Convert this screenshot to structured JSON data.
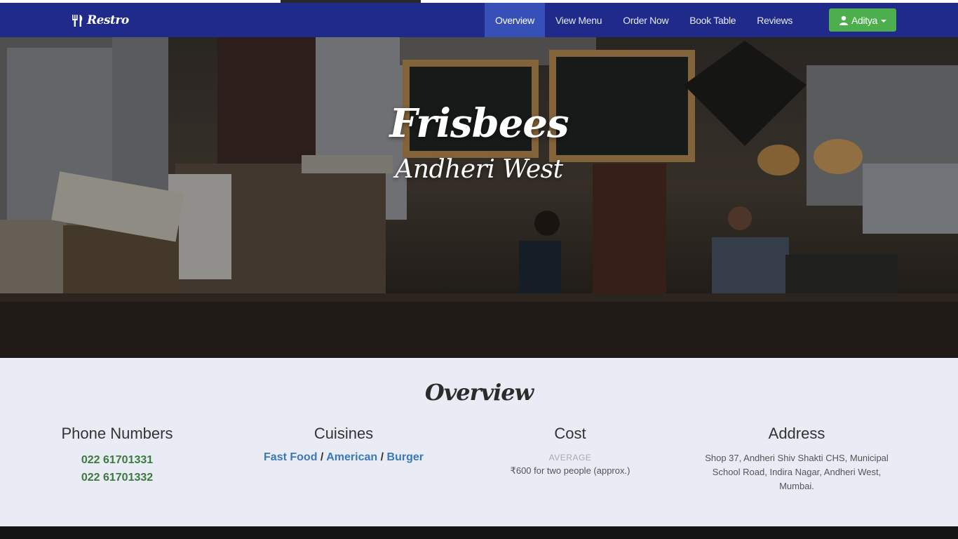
{
  "navbar": {
    "brand": "Restro",
    "brand_icon": "fork-knife-icon",
    "items": [
      {
        "label": "Overview",
        "active": true
      },
      {
        "label": "View Menu",
        "active": false
      },
      {
        "label": "Order Now",
        "active": false
      },
      {
        "label": "Book Table",
        "active": false
      },
      {
        "label": "Reviews",
        "active": false
      }
    ],
    "user": {
      "label": "Aditya",
      "icon": "user-icon"
    }
  },
  "hero": {
    "title": "Frisbees",
    "subtitle": "Andheri West"
  },
  "overview": {
    "title": "Overview",
    "phone": {
      "heading": "Phone Numbers",
      "numbers": [
        "022 61701331",
        "022 61701332"
      ]
    },
    "cuisines": {
      "heading": "Cuisines",
      "items": [
        "Fast Food",
        "American",
        "Burger"
      ],
      "separator": "/"
    },
    "cost": {
      "heading": "Cost",
      "tag": "AVERAGE",
      "value": "₹600 for two people (approx.)"
    },
    "address": {
      "heading": "Address",
      "text": "Shop 37, Andheri Shiv Shakti CHS, Municipal School Road, Indira Nagar, Andheri West, Mumbai."
    }
  },
  "colors": {
    "navbar": "#1f2a8a",
    "nav_active": "#3650b8",
    "user_button": "#4cae4c",
    "phone_text": "#3c7a3c",
    "link": "#3a78b8",
    "section_bg": "#e9ebf5"
  }
}
